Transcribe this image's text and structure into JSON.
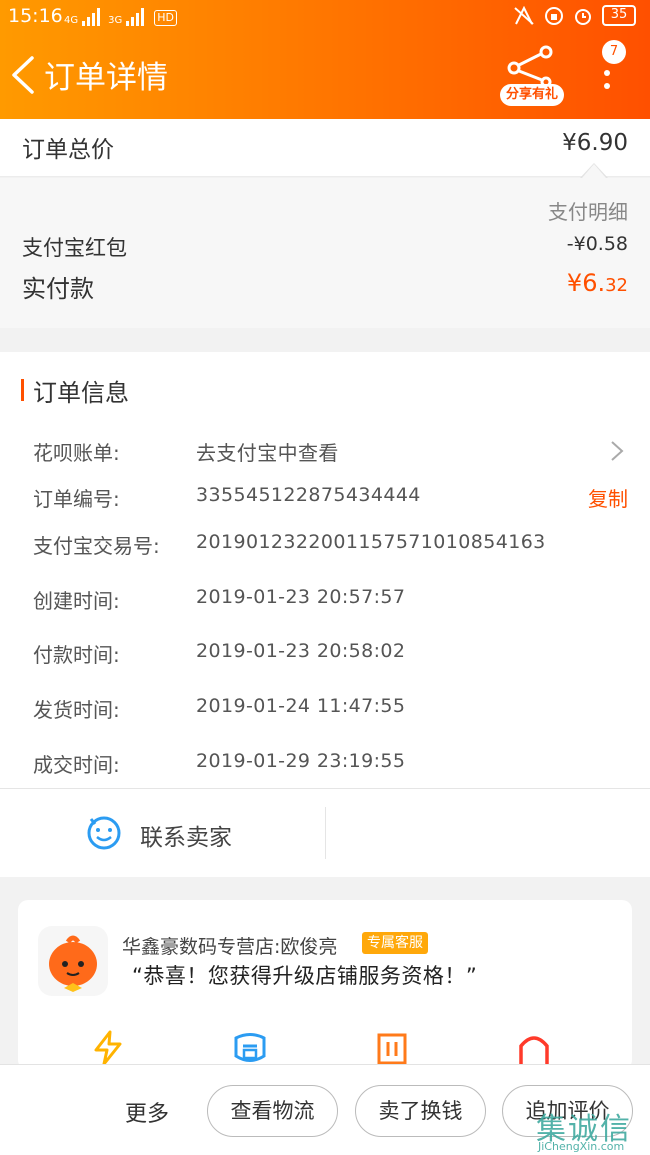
{
  "status_bar": {
    "time": "15:16",
    "net1": "4G",
    "net2": "3G",
    "hd": "HD",
    "battery": "35"
  },
  "header": {
    "title": "订单详情",
    "share_label": "分享有礼",
    "more_badge": "7"
  },
  "total": {
    "label": "订单总价",
    "value": "¥6.90"
  },
  "payment": {
    "detail_label": "支付明细",
    "redpack_label": "支付宝红包",
    "redpack_value": "-¥0.58",
    "paid_label": "实付款",
    "paid_currency_main": "¥6.",
    "paid_cents": "32"
  },
  "order_info": {
    "title": "订单信息",
    "rows": [
      {
        "label": "花呗账单:",
        "value": "去支付宝中查看"
      },
      {
        "label": "订单编号:",
        "value": "335545122875434444",
        "action": "复制"
      },
      {
        "label": "支付宝交易号:",
        "value": "2019012322001157571010854163"
      },
      {
        "label": "创建时间:",
        "value": "2019-01-23 20:57:57"
      },
      {
        "label": "付款时间:",
        "value": "2019-01-23 20:58:02"
      },
      {
        "label": "发货时间:",
        "value": "2019-01-24 11:47:55"
      },
      {
        "label": "成交时间:",
        "value": "2019-01-29 23:19:55"
      }
    ],
    "contact_label": "联系卖家"
  },
  "shop": {
    "name": "华鑫豪数码专营店:欧俊亮",
    "service_tag": "专属客服",
    "message": "“恭喜！您获得升级店铺服务资格！”"
  },
  "bottom_bar": {
    "more": "更多",
    "buttons": [
      "查看物流",
      "卖了换钱",
      "追加评价"
    ]
  },
  "watermark": {
    "cn": "集诚信",
    "en": "JiChengXin.com"
  },
  "colors": {
    "accent": "#ff5000",
    "header_start": "#ff9a00",
    "tag": "#ffa80a"
  }
}
